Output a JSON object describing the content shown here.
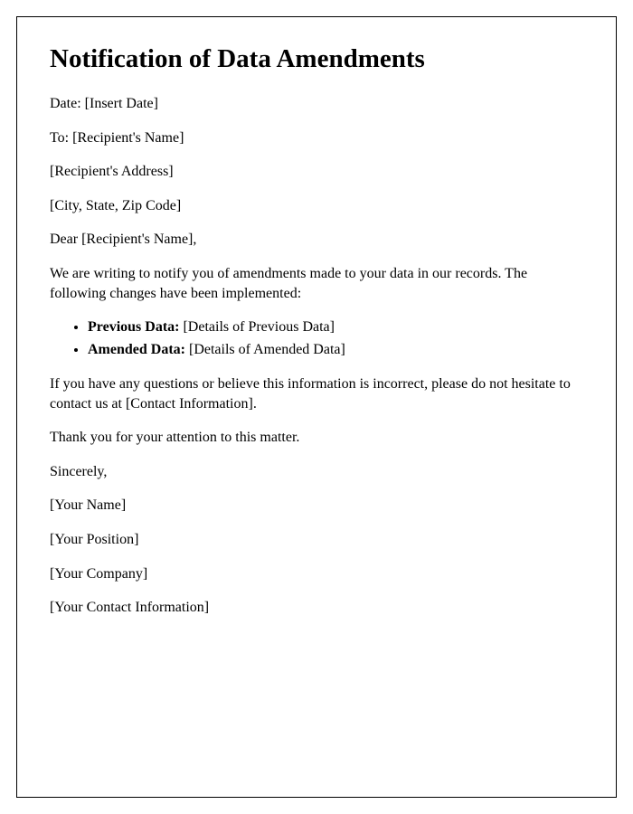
{
  "title": "Notification of Data Amendments",
  "date": {
    "label": "Date: ",
    "value": "[Insert Date]"
  },
  "to": {
    "label": "To: ",
    "value": "[Recipient's Name]"
  },
  "recipientAddress": "[Recipient's Address]",
  "cityStateZip": "[City, State, Zip Code]",
  "salutation": "Dear [Recipient's Name],",
  "intro": "We are writing to notify you of amendments made to your data in our records. The following changes have been implemented:",
  "items": [
    {
      "label": "Previous Data:",
      "value": " [Details of Previous Data]"
    },
    {
      "label": "Amended Data:",
      "value": " [Details of Amended Data]"
    }
  ],
  "questions": "If you have any questions or believe this information is incorrect, please do not hesitate to contact us at [Contact Information].",
  "thanks": "Thank you for your attention to this matter.",
  "closing": "Sincerely,",
  "signerName": "[Your Name]",
  "signerPosition": "[Your Position]",
  "signerCompany": "[Your Company]",
  "signerContact": "[Your Contact Information]"
}
